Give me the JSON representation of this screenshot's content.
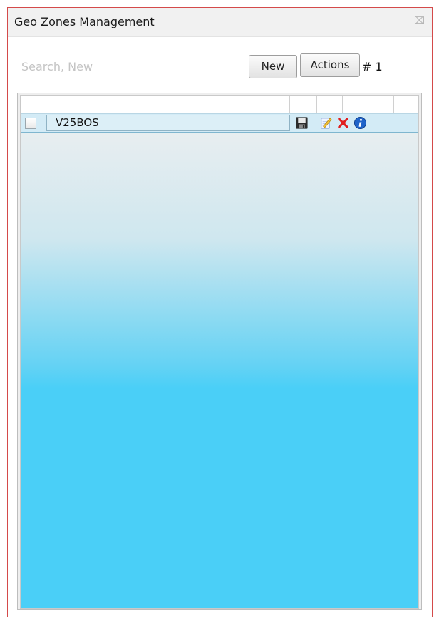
{
  "window": {
    "title": "Geo Zones Management",
    "close_glyph": "⌧"
  },
  "toolbar": {
    "search_placeholder": "Search, New",
    "new_label": "New",
    "actions_label": "Actions",
    "count_label": "# 1"
  },
  "grid": {
    "rows": [
      {
        "name": "V25BOS",
        "actions": [
          "save-icon",
          "edit-icon",
          "delete-icon",
          "info-icon"
        ]
      }
    ]
  },
  "colors": {
    "window_border": "#d44a4a",
    "grid_gradient_bottom": "#4acff7",
    "delete": "#e02020",
    "info": "#1f63c9"
  }
}
